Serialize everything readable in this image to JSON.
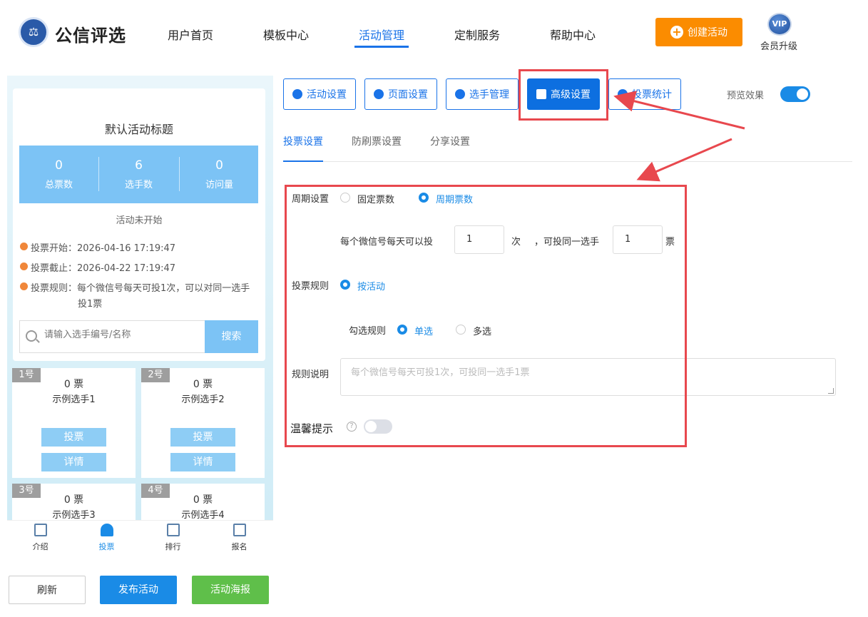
{
  "header": {
    "brand": "公信评选",
    "nav": [
      "用户首页",
      "模板中心",
      "活动管理",
      "定制服务",
      "帮助中心"
    ],
    "active_nav": "活动管理",
    "create_label": "创建活动",
    "vip_badge": "VIP",
    "vip_label": "会员升级"
  },
  "preview": {
    "title": "默认活动标题",
    "stats": [
      {
        "num": "0",
        "label": "总票数"
      },
      {
        "num": "6",
        "label": "选手数"
      },
      {
        "num": "0",
        "label": "访问量"
      }
    ],
    "status": "活动未开始",
    "info": [
      "投票开始：2026-04-16 17:19:47",
      "投票截止：2026-04-22 17:19:47",
      "投票规则：每个微信号每天可投1次，可以对同一选手",
      "投1票"
    ],
    "search_placeholder": "请输入选手编号/名称",
    "search_label": "搜索",
    "players": [
      {
        "tag": "1号",
        "votes": "0 票",
        "name": "示例选手1"
      },
      {
        "tag": "2号",
        "votes": "0 票",
        "name": "示例选手2"
      },
      {
        "tag": "3号",
        "votes": "0 票",
        "name": "示例选手3"
      },
      {
        "tag": "4号",
        "votes": "0 票",
        "name": "示例选手4"
      }
    ],
    "vote_label": "投票",
    "detail_label": "详情",
    "bottom_nav": [
      "介绍",
      "投票",
      "排行",
      "报名"
    ],
    "buttons": {
      "refresh": "刷新",
      "publish": "发布活动",
      "poster": "活动海报"
    }
  },
  "settings": {
    "tabs": [
      "活动设置",
      "页面设置",
      "选手管理",
      "高级设置",
      "投票统计"
    ],
    "active_tab": "高级设置",
    "preview_label": "预览效果",
    "subtabs": [
      "投票设置",
      "防刷票设置",
      "分享设置"
    ],
    "period": {
      "label": "周期设置",
      "options": [
        "固定票数",
        "周期票数"
      ],
      "selected": "周期票数"
    },
    "per_day_label": "每个微信号每天可以投",
    "per_day_value": "1",
    "times_unit": "次",
    "same_player_label": "，可投同一选手",
    "same_player_value": "1",
    "votes_unit": "票",
    "rule": {
      "label": "投票规则",
      "option": "按活动"
    },
    "check": {
      "label": "勾选规则",
      "options": [
        "单选",
        "多选"
      ],
      "selected": "单选"
    },
    "desc": {
      "label": "规则说明",
      "placeholder": "每个微信号每天可投1次，可投同一选手1票"
    },
    "tip": {
      "label": "温馨提示",
      "help": "?"
    }
  },
  "colors": {
    "accent": "#1a73e8",
    "orange": "#fb8c00",
    "annotation": "#e8484e",
    "light_blue": "#7cc3f5"
  }
}
